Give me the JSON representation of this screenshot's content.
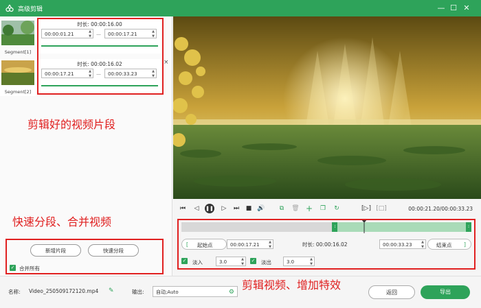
{
  "window": {
    "title": "高级剪辑",
    "minimize": "—",
    "maximize": "☐",
    "close": "✕"
  },
  "segments": [
    {
      "label": "Segment[1]",
      "duration": "时长: 00:00:16.00",
      "start": "00:00:01.21",
      "end": "00:00:17.21",
      "progress": 1.0
    },
    {
      "label": "Segment[2]",
      "duration": "时长: 00:00:16.02",
      "start": "00:00:17.21",
      "end": "00:00:33.23",
      "progress": 1.0
    }
  ],
  "segment_close": "×",
  "annotations": {
    "segments": "剪辑好的视频片段",
    "split_merge": "快速分段、合并视频",
    "edit": "剪辑视频、增加特效"
  },
  "left_actions": {
    "add_segment": "新增片段",
    "quick_split": "快速分段",
    "merge_all": "合并所有"
  },
  "player": {
    "timecode": "00:00:21.20/00:00:33.23",
    "range_open": "[▷]",
    "range_close": "[□]"
  },
  "editor": {
    "start_label": "起始点",
    "start_value": "00:00:17.21",
    "duration_label": "时长: 00:00:16.02",
    "end_value": "00:00:33.23",
    "end_label": "结束点",
    "fade_in_label": "淡入",
    "fade_in_value": "3.0",
    "fade_out_label": "淡出",
    "fade_out_value": "3.0",
    "selection_start": 0.52,
    "selection_end": 1.0,
    "playhead": 0.63
  },
  "bottom": {
    "name_label": "名称:",
    "name_value": "Video_250509172120.mp4",
    "output_label": "输出:",
    "output_value": "自动;Auto",
    "back_button": "返回",
    "export_button": "导出"
  },
  "colors": {
    "accent": "#2ea35a",
    "annotation": "#e02020"
  }
}
